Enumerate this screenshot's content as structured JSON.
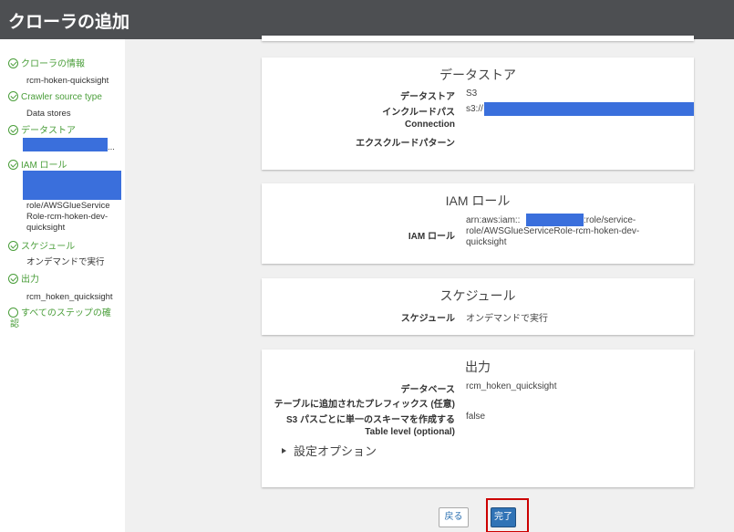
{
  "header": {
    "title": "クローラの追加"
  },
  "sidebar": {
    "steps": [
      {
        "label": "クローラの情報",
        "value": "rcm-hoken-quicksight"
      },
      {
        "label": "Crawler source type",
        "value": "Data stores"
      },
      {
        "label": "データストア",
        "value": "..."
      },
      {
        "label": "IAM ロール",
        "value_lines": [
          "role/AWSGlueService",
          "Role-rcm-hoken-dev-",
          "quicksight"
        ]
      },
      {
        "label": "スケジュール",
        "value": "オンデマンドで実行"
      },
      {
        "label": "出力",
        "value": "rcm_hoken_quicksight"
      },
      {
        "label_lines": [
          "すべてのステップの確",
          "認"
        ]
      }
    ]
  },
  "datastore": {
    "title": "データストア",
    "rows": [
      {
        "label": "データストア",
        "value": "S3"
      },
      {
        "label": "インクルードパス",
        "value": "s3://"
      },
      {
        "label": "Connection",
        "value": ""
      },
      {
        "label": "エクスクルードパターン",
        "value": ""
      }
    ]
  },
  "iam": {
    "title": "IAM ロール",
    "label": "IAM ロール",
    "value_line1_prefix": "arn:aws:iam::",
    "value_line1_suffix": ":role/service-",
    "value_line2": "role/AWSGlueServiceRole-rcm-hoken-dev-",
    "value_line3": "quicksight"
  },
  "schedule": {
    "title": "スケジュール",
    "label": "スケジュール",
    "value": "オンデマンドで実行"
  },
  "output": {
    "title": "出力",
    "rows": [
      {
        "label": "データベース",
        "value": "rcm_hoken_quicksight"
      },
      {
        "label": "テーブルに追加されたプレフィックス (任意)",
        "value": ""
      },
      {
        "label": "S3 パスごとに単一のスキーマを作成する",
        "value": "false"
      },
      {
        "label": "Table level (optional)",
        "value": ""
      }
    ],
    "options_label": "設定オプション"
  },
  "buttons": {
    "back": "戻る",
    "finish": "完了"
  },
  "colors": {
    "header_bg": "#4d4f52",
    "step_green": "#4a9e3a",
    "redaction": "#3a6fdc",
    "primary_button": "#3073b6",
    "highlight": "#cc0000"
  }
}
